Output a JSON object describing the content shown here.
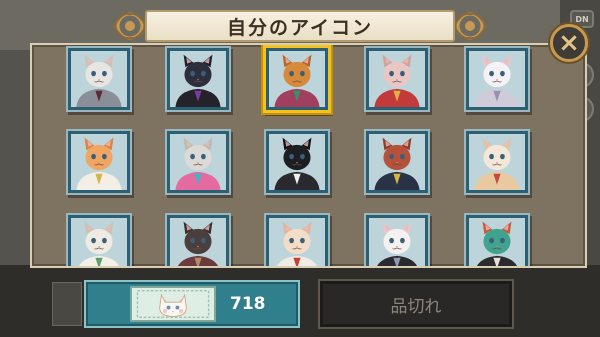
{
  "title": "自分のアイコン",
  "close_symbol": "×",
  "side_buttons": {
    "top_label": "DN",
    "help_symbol": "?"
  },
  "icons": [
    {
      "name": "gray-cat-suit",
      "fur": "#e8e6e2",
      "ear": "#c9c3ba",
      "suit": "#8a8e96",
      "accent": "#5c2b35"
    },
    {
      "name": "black-cat-purple",
      "fur": "#2e2f3c",
      "ear": "#1f2030",
      "suit": "#24232a",
      "accent": "#7d3aa4"
    },
    {
      "name": "tiger-cat-colorful",
      "fur": "#d78a3a",
      "ear": "#b8652a",
      "suit": "#a23e5e",
      "accent": "#3a8f6a"
    },
    {
      "name": "pink-cat-scarf",
      "fur": "#e9c7c4",
      "ear": "#d4a09c",
      "suit": "#c23a3a",
      "accent": "#e0b040"
    },
    {
      "name": "white-cat-fluffy",
      "fur": "#f4f2f6",
      "ear": "#e2c6d0",
      "suit": "#cfcbd8",
      "accent": "#9a8fb0"
    },
    {
      "name": "orange-cat-scarf",
      "fur": "#f0a562",
      "ear": "#d98544",
      "suit": "#f4efe6",
      "accent": "#d8b34a"
    },
    {
      "name": "gray-cat-sunglasses",
      "fur": "#dcdad6",
      "ear": "#bdb8b0",
      "suit": "#e46aa0",
      "accent": "#3fb7c0"
    },
    {
      "name": "tuxedo-cat",
      "fur": "#1d1e22",
      "ear": "#101114",
      "suit": "#2a2a2e",
      "accent": "#f2f0ea"
    },
    {
      "name": "cat-police-cap",
      "fur": "#b5523c",
      "ear": "#8f3d2c",
      "suit": "#2a3246",
      "accent": "#d9b24a"
    },
    {
      "name": "cat-sunhat",
      "fur": "#f2e7d8",
      "ear": "#d9c6ae",
      "suit": "#e8c9a0",
      "accent": "#c84a3a"
    },
    {
      "name": "tabby-cat-bow",
      "fur": "#efeae2",
      "ear": "#c9c2b7",
      "suit": "#f4f0e8",
      "accent": "#5aa06e"
    },
    {
      "name": "dark-cat-pirate",
      "fur": "#4b3f3e",
      "ear": "#3a302f",
      "suit": "#6b3b3e",
      "accent": "#b38b6d"
    },
    {
      "name": "cream-cat-redtie",
      "fur": "#f3ddc8",
      "ear": "#e1b69c",
      "suit": "#f0ebe4",
      "accent": "#c23f3a"
    },
    {
      "name": "white-cat-black-suit",
      "fur": "#f5f1f0",
      "ear": "#e4c9cc",
      "suit": "#2a2a30",
      "accent": "#8e9ab8"
    },
    {
      "name": "calico-cat",
      "fur": "#3fa38e",
      "ear": "#c55a3a",
      "suit": "#2b2b30",
      "accent": "#e6e0d4"
    }
  ],
  "selected_index": 2,
  "purchase": {
    "price": "718",
    "ticket_icon": "cat-ticket-icon"
  },
  "soldout_label": "品切れ",
  "colors": {
    "panel": "#7e7261",
    "cell_border": "#2b5f71",
    "selected_border": "#f4c21a",
    "price_button": "#2f7f8c",
    "close_ring": "#c79a52"
  }
}
